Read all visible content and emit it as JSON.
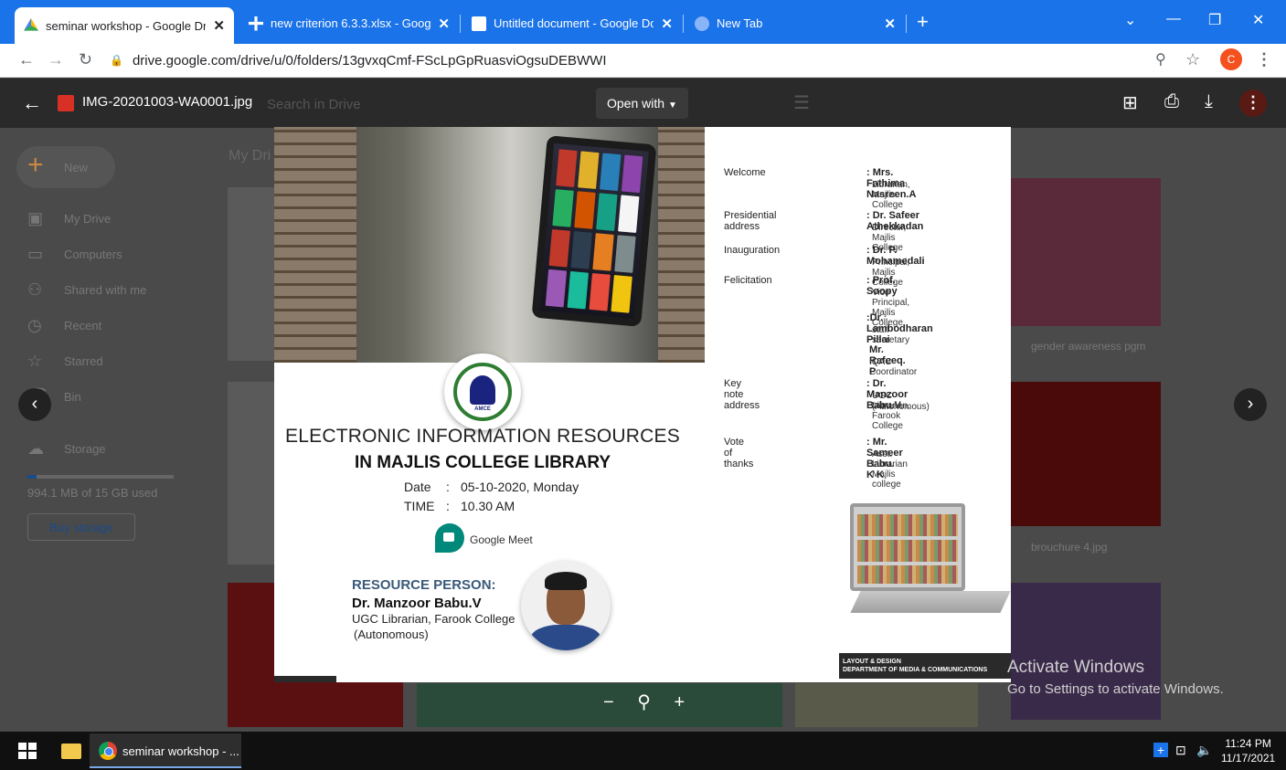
{
  "browser": {
    "tabs": [
      {
        "title": "seminar workshop - Google Drive",
        "active": true
      },
      {
        "title": "new criterion 6.3.3.xlsx - Google Sheets",
        "active": false
      },
      {
        "title": "Untitled document - Google Docs",
        "active": false
      },
      {
        "title": "New Tab",
        "active": false
      }
    ],
    "new_tab": "+",
    "url": "drive.google.com/drive/u/0/folders/13gvxqCmf-FScLpGpRuasviOgsuDEBWWI",
    "profile_initial": "C",
    "window_controls": {
      "chevron": "⌄",
      "minimize": "—",
      "restore": "❐",
      "close": "✕"
    }
  },
  "viewer": {
    "file_name": "IMG-20201003-WA0001.jpg",
    "search_placeholder": "Search in Drive",
    "open_with": "Open with",
    "more": "⋮"
  },
  "drive": {
    "new_label": "New",
    "my_drive_header": "My Dri",
    "sidebar": [
      {
        "label": "My Drive",
        "icon": "drive-icon"
      },
      {
        "label": "Computers",
        "icon": "computer-icon"
      },
      {
        "label": "Shared with me",
        "icon": "people-icon"
      },
      {
        "label": "Recent",
        "icon": "clock-icon"
      },
      {
        "label": "Starred",
        "icon": "star-icon"
      },
      {
        "label": "Bin",
        "icon": "trash-icon"
      },
      {
        "label": "Storage",
        "icon": "cloud-icon"
      }
    ],
    "storage_used_fraction": 0.06,
    "storage_text": "994.1 MB of 15 GB used",
    "buy_storage": "Buy storage",
    "file_labels": [
      "gender awareness pgm",
      "brouchure 4.jpg"
    ]
  },
  "poster": {
    "title_line1": "ELECTRONIC INFORMATION RESOURCES",
    "title_line2": "IN MAJLIS COLLEGE LIBRARY",
    "date_key": "Date",
    "date_value": "05-10-2020, Monday",
    "time_key": "TIME",
    "time_value": "10.30 AM",
    "meet_label": "Google Meet",
    "resource_head": "RESOURCE PERSON:",
    "resource_name": "Dr. Manzoor Babu.V",
    "resource_role": "UGC Librarian, Farook College",
    "resource_aff": "(Autonomous)",
    "logo_text": "AMCE",
    "program": [
      {
        "label": "Welcome",
        "name": ": Mrs. Fathima Nasreen.A",
        "role": "Librarian, Majlis College"
      },
      {
        "label": "Presidential address",
        "name": ": Dr. Safeer Athekkadan",
        "role": "Director, Majlis College"
      },
      {
        "label": "Inauguration",
        "name": ": Dr. P. Mohamedali",
        "role": "Principal, Majlis College"
      },
      {
        "label": "Felicitation",
        "name": ": Prof. Soopy",
        "role": "Vice Principal, Majlis College"
      },
      {
        "label": "",
        "name": ":Dr. Lambodharan Pillai",
        "role": "staff secretary"
      },
      {
        "label": "",
        "name": "Mr. Rafeeq. P",
        "role": "IQAC Coordinator"
      },
      {
        "label": "Key note address",
        "name": ": Dr. Manzoor Babu.V",
        "role": "UGC Librarian, Farook College",
        "role2": "(Autonomous)"
      },
      {
        "label": "Vote of thanks",
        "name": ": Mr. Sameer Babu. K K",
        "role": "Asst. Librarian Majlis college"
      }
    ],
    "footer_line1": "LAYOUT & DESIGN",
    "footer_line2": "DEPARTMENT OF MEDIA & COMMUNICATIONS"
  },
  "overlay": {
    "activate_title": "Activate Windows",
    "activate_sub": "Go to Settings to activate Windows."
  },
  "taskbar": {
    "chrome_label": "seminar workshop - ...",
    "time": "11:24 PM",
    "date": "11/17/2021"
  }
}
